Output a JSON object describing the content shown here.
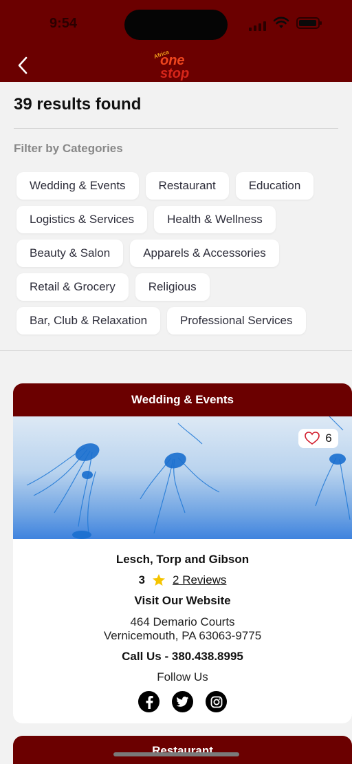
{
  "status_bar": {
    "time": "9:54"
  },
  "header": {
    "logo_small": "Africa",
    "logo_main_top": "one",
    "logo_main_bottom": "stop"
  },
  "results": {
    "text": "39 results found"
  },
  "filter": {
    "title": "Filter by Categories",
    "rows": [
      [
        "Wedding & Events",
        "Restaurant",
        "Education"
      ],
      [
        "Logistics & Services",
        "Health & Wellness"
      ],
      [
        "Beauty & Salon",
        "Apparels & Accessories"
      ],
      [
        "Retail & Grocery",
        "Religious"
      ],
      [
        "Bar, Club & Relaxation",
        "Professional Services"
      ]
    ]
  },
  "card": {
    "category": "Wedding & Events",
    "likes": "6",
    "name": "Lesch, Torp and Gibson",
    "rating": "3",
    "reviews": "2 Reviews",
    "website": "Visit Our Website",
    "address_line1": "464 Demario Courts",
    "address_line2": "Vernicemouth, PA 63063-9775",
    "call": "Call Us - 380.438.8995",
    "follow": "Follow Us",
    "socials": [
      "facebook-icon",
      "twitter-icon",
      "instagram-icon"
    ]
  },
  "next_card": {
    "category": "Restaurant"
  },
  "colors": {
    "brand": "#6b0000",
    "background": "#f2f2f2",
    "star": "#f5c400",
    "heart": "#d11a2a"
  }
}
